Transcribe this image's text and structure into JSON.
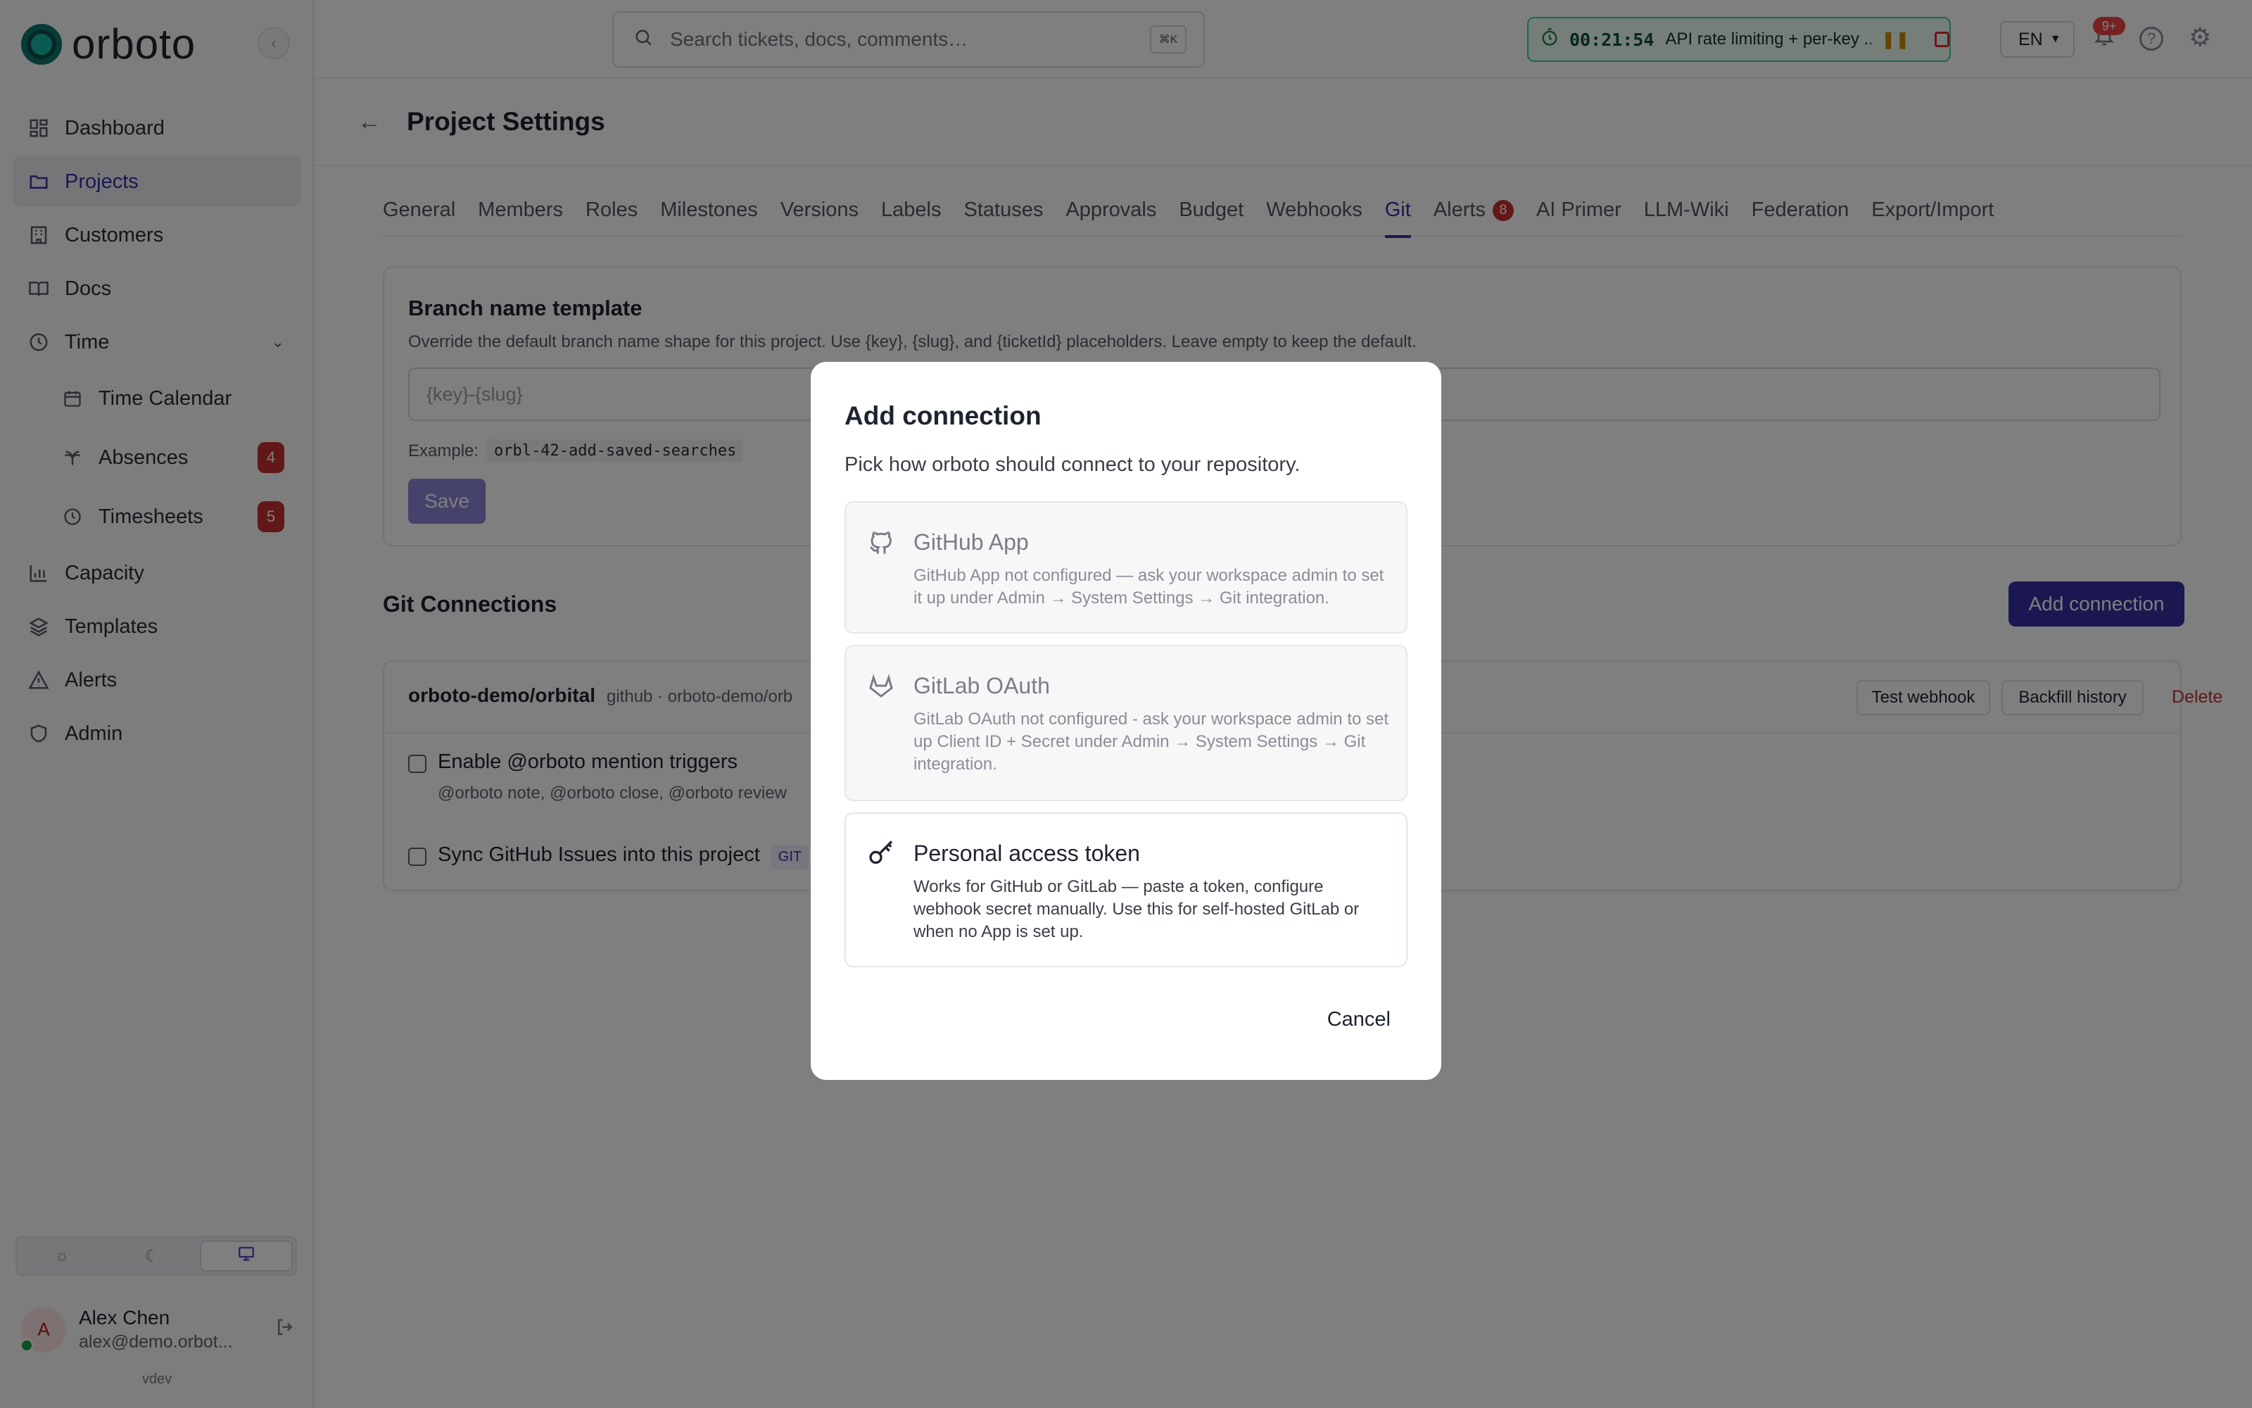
{
  "app": {
    "name": "orboto"
  },
  "sidebar": {
    "items": [
      {
        "label": "Dashboard",
        "icon": "dashboard-icon"
      },
      {
        "label": "Projects",
        "icon": "folder-icon"
      },
      {
        "label": "Customers",
        "icon": "building-icon"
      },
      {
        "label": "Docs",
        "icon": "book-icon"
      },
      {
        "label": "Time",
        "icon": "clock-icon"
      },
      {
        "label": "Time Calendar",
        "icon": "calendar-icon"
      },
      {
        "label": "Absences",
        "icon": "palm-icon",
        "badge": "4"
      },
      {
        "label": "Timesheets",
        "icon": "clock-icon",
        "badge": "5"
      },
      {
        "label": "Capacity",
        "icon": "bar-chart-icon"
      },
      {
        "label": "Templates",
        "icon": "layers-icon"
      },
      {
        "label": "Alerts",
        "icon": "alert-icon"
      },
      {
        "label": "Admin",
        "icon": "shield-icon"
      }
    ],
    "active": "Projects",
    "user": {
      "initial": "A",
      "name": "Alex Chen",
      "email": "alex@demo.orbot..."
    },
    "version": "vdev"
  },
  "topbar": {
    "search_placeholder": "Search tickets, docs, comments…",
    "search_kbd": "⌘K",
    "timer": {
      "time": "00:21:54",
      "title": "API rate limiting + per-key ..."
    },
    "language": "EN",
    "notifications_badge": "9+"
  },
  "page": {
    "title": "Project Settings",
    "tabs": [
      {
        "label": "General"
      },
      {
        "label": "Members"
      },
      {
        "label": "Roles"
      },
      {
        "label": "Milestones"
      },
      {
        "label": "Versions"
      },
      {
        "label": "Labels"
      },
      {
        "label": "Statuses"
      },
      {
        "label": "Approvals"
      },
      {
        "label": "Budget"
      },
      {
        "label": "Webhooks"
      },
      {
        "label": "Git"
      },
      {
        "label": "Alerts",
        "count": "8"
      },
      {
        "label": "AI Primer"
      },
      {
        "label": "LLM-Wiki"
      },
      {
        "label": "Federation"
      },
      {
        "label": "Export/Import"
      }
    ],
    "active_tab": "Git",
    "branch": {
      "title": "Branch name template",
      "description": "Override the default branch name shape for this project. Use {key}, {slug}, and {ticketId} placeholders. Leave empty to keep the default.",
      "placeholder": "{key}-{slug}",
      "example_label": "Example:",
      "example_value": "orbl-42-add-saved-searches",
      "save_label": "Save"
    },
    "git": {
      "title": "Git Connections",
      "add_label": "Add connection",
      "repo": {
        "name": "orboto-demo/orbital",
        "meta": "github · orboto-demo/orb"
      },
      "test_label": "Test webhook",
      "backfill_label": "Backfill history",
      "delete_label": "Delete",
      "mention_label": "Enable @orboto mention triggers",
      "mention_sub": "@orboto note, @orboto close, @orboto review",
      "sync_label": "Sync GitHub Issues into this project",
      "sync_tag": "GIT"
    }
  },
  "modal": {
    "title": "Add connection",
    "subtitle": "Pick how orboto should connect to your repository.",
    "options": [
      {
        "title": "GitHub App",
        "desc": "GitHub App not configured — ask your workspace admin to set it up under Admin → System Settings → Git integration.",
        "icon": "github-icon",
        "enabled": false
      },
      {
        "title": "GitLab OAuth",
        "desc": "GitLab OAuth not configured - ask your workspace admin to set up Client ID + Secret under Admin → System Settings → Git integration.",
        "icon": "gitlab-icon",
        "enabled": false
      },
      {
        "title": "Personal access token",
        "desc": "Works for GitHub or GitLab — paste a token, configure webhook secret manually. Use this for self-hosted GitLab or when no App is set up.",
        "icon": "key-icon",
        "enabled": true
      }
    ],
    "cancel_label": "Cancel"
  },
  "colors": {
    "accent": "#3730a3",
    "danger": "#c53030",
    "timer_border": "#34d399"
  }
}
